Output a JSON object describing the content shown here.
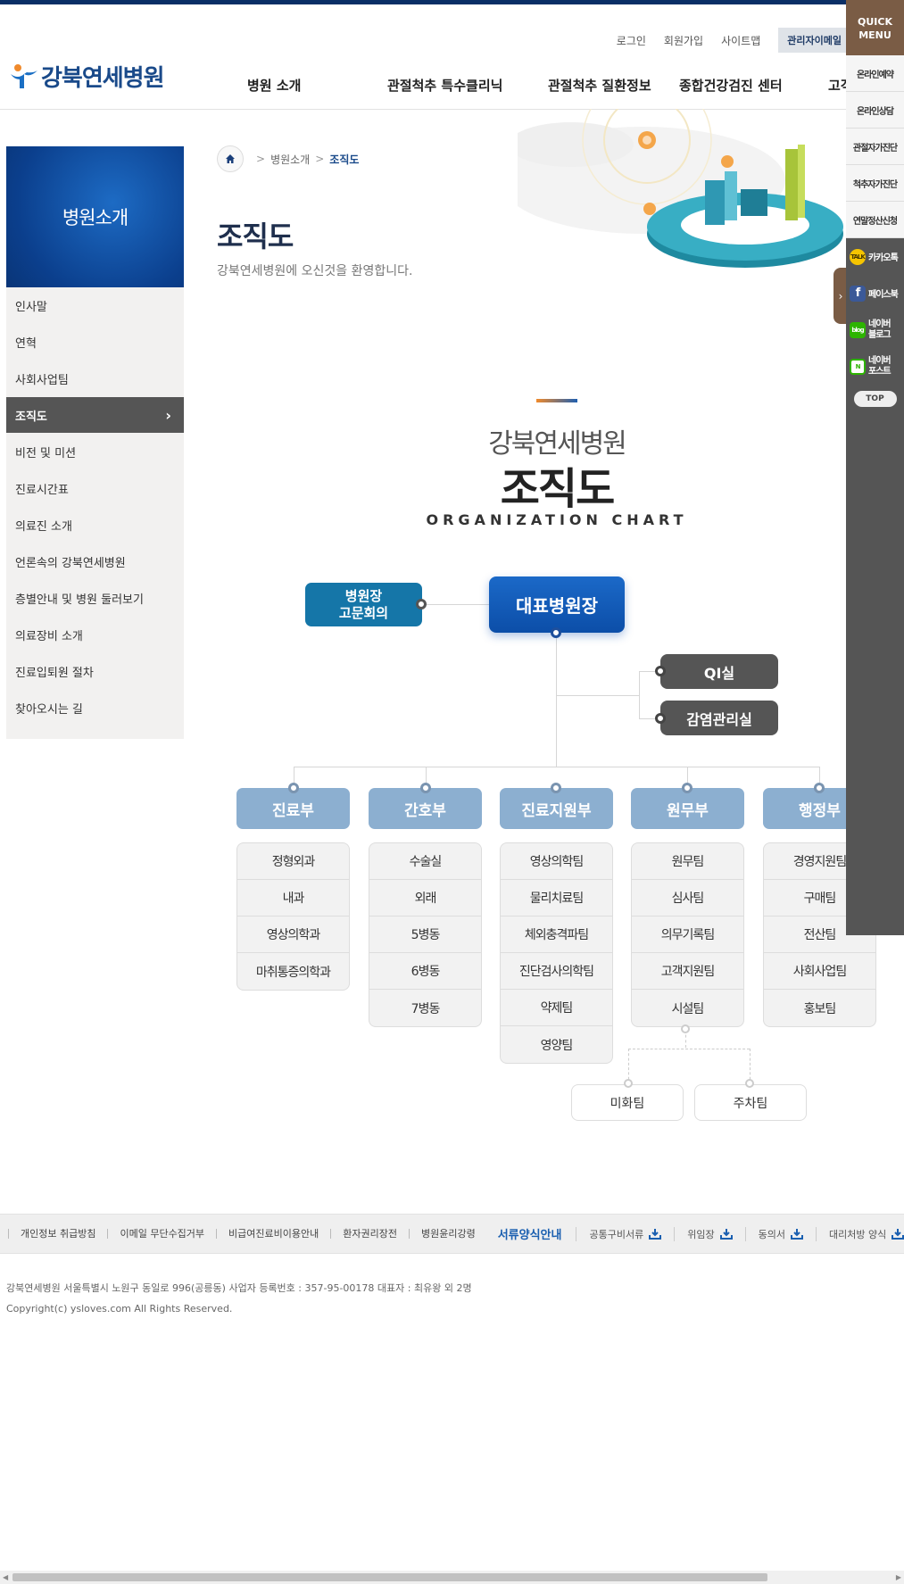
{
  "header": {
    "util": [
      "로그인",
      "회원가입",
      "사이트맵"
    ],
    "admin_mail": "관리자이메일",
    "logo": "강북연세병원",
    "nav": [
      "병원 소개",
      "관절척추 특수클리닉",
      "관절척추 질환정보",
      "종합건강검진 센터",
      "고객"
    ]
  },
  "sidebar": {
    "title": "병원소개",
    "items": [
      "인사말",
      "연혁",
      "사회사업팀",
      "조직도",
      "비전 및 미션",
      "진료시간표",
      "의료진 소개",
      "언론속의 강북연세병원",
      "층별안내 및 병원 둘러보기",
      "의료장비 소개",
      "진료입퇴원 절차",
      "찾아오시는 길"
    ],
    "active": "조직도"
  },
  "breadcrumb": {
    "parent": "병원소개",
    "current": "조직도"
  },
  "page": {
    "title": "조직도",
    "subtitle": "강북연세병원에 오신것을 환영합니다."
  },
  "org_chart": {
    "title_small": "강북연세병원",
    "title_big": "조직도",
    "title_en": "ORGANIZATION CHART",
    "ceo": "대표병원장",
    "council": [
      "병원장",
      "고문회의"
    ],
    "staff": [
      "QI실",
      "감염관리실"
    ],
    "departments": [
      {
        "name": "진료부",
        "teams": [
          "정형외과",
          "내과",
          "영상의학과",
          "마취통증의학과"
        ]
      },
      {
        "name": "간호부",
        "teams": [
          "수술실",
          "외래",
          "5병동",
          "6병동",
          "7병동"
        ]
      },
      {
        "name": "진료지원부",
        "teams": [
          "영상의학팀",
          "물리치료팀",
          "체외충격파팀",
          "진단검사의학팀",
          "약제팀",
          "영양팀"
        ]
      },
      {
        "name": "원무부",
        "teams": [
          "원무팀",
          "심사팀",
          "의무기록팀",
          "고객지원팀",
          "시설팀"
        ]
      },
      {
        "name": "행정부",
        "teams": [
          "경영지원팀",
          "구매팀",
          "전산팀",
          "사회사업팀",
          "홍보팀"
        ]
      }
    ],
    "sub_teams": [
      "미화팀",
      "주차팀"
    ]
  },
  "quick_menu": {
    "title": [
      "QUICK",
      "MENU"
    ],
    "items": [
      "온라인예약",
      "온라인상담",
      "관절자가진단",
      "척추자가진단",
      "연말정산신청"
    ],
    "sns": [
      {
        "label": "카카오톡",
        "icon": "kakaotalk-icon",
        "color": "#f5c400"
      },
      {
        "label": "페이스북",
        "icon": "facebook-icon",
        "color": "#3b5998"
      },
      {
        "label": "네이버 블로그",
        "icon": "naver-blog-icon",
        "color": "#2db400"
      },
      {
        "label": "네이버 포스트",
        "icon": "naver-post-icon",
        "color": "#2db400"
      }
    ],
    "top": "TOP"
  },
  "footer": {
    "links": [
      "개인정보 취급방침",
      "이메일 무단수집거부",
      "비급여진료비이용안내",
      "환자권리장전",
      "병원윤리강령"
    ],
    "forms_title": "서류양식안내",
    "forms": [
      "공통구비서류",
      "위임장",
      "동의서",
      "대리처방 양식"
    ],
    "address": "강북연세병원 서울특별시 노원구 동일로 996(공릉동) 사업자 등록번호 : 357-95-00178 대표자 : 최유왕 외 2명",
    "copyright": "Copyright(c) ysloves.com All Rights Reserved."
  },
  "colors": {
    "brand": "#0a2f66",
    "accent": "#1b69c8",
    "dept": "#8cafd0",
    "quick": "#7a5c45"
  }
}
